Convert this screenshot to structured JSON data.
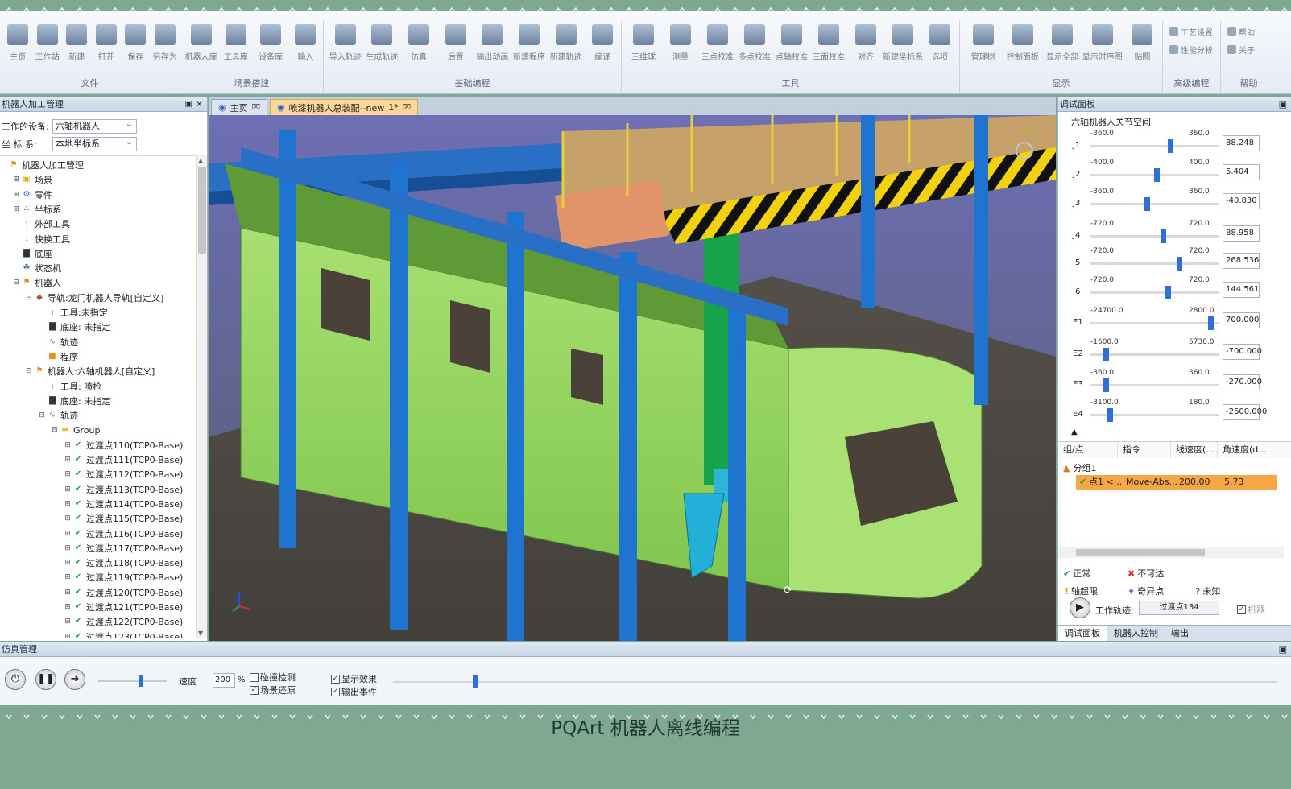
{
  "ribbon": {
    "groups": [
      {
        "label": "文件",
        "buttons": [
          "主页",
          "工作站",
          "新建",
          "打开",
          "保存",
          "另存为"
        ]
      },
      {
        "label": "场景搭建",
        "buttons": [
          "机器人库",
          "工具库",
          "设备库",
          "输入"
        ]
      },
      {
        "label": "基础编程",
        "buttons": [
          "导入轨迹",
          "生成轨迹",
          "仿真",
          "后置",
          "输出动画",
          "新建程序",
          "新建轨迹",
          "编译"
        ]
      },
      {
        "label": "工具",
        "buttons": [
          "三维球",
          "测量",
          "三点校准",
          "多点校准",
          "点轴校准",
          "三面校准",
          "对齐",
          "新建坐标系",
          "选项"
        ]
      },
      {
        "label": "显示",
        "buttons": [
          "管理树",
          "控制面板",
          "显示全部",
          "显示时序图",
          "贴图"
        ]
      },
      {
        "label": "高级编程",
        "buttons": [
          "工艺设置",
          "性能分析"
        ]
      },
      {
        "label": "帮助",
        "buttons": [
          "帮助",
          "关于"
        ]
      }
    ]
  },
  "left_panel": {
    "title": "机器人加工管理",
    "device_label": "工作的设备:",
    "device_value": "六轴机器人",
    "coord_label": "坐 标 系:",
    "coord_value": "本地坐标系",
    "tree": [
      {
        "label": "机器人加工管理",
        "icon": "robot-folder-icon",
        "indent": 0,
        "expand": ""
      },
      {
        "label": "场景",
        "icon": "scene-icon",
        "indent": 1,
        "expand": "+"
      },
      {
        "label": "零件",
        "icon": "part-icon",
        "indent": 1,
        "expand": "+"
      },
      {
        "label": "坐标系",
        "icon": "coordinate-icon",
        "indent": 1,
        "expand": "+"
      },
      {
        "label": "外部工具",
        "icon": "tool-icon",
        "indent": 1,
        "expand": ""
      },
      {
        "label": "快换工具",
        "icon": "tool-icon",
        "indent": 1,
        "expand": ""
      },
      {
        "label": "底座",
        "icon": "base-icon",
        "indent": 1,
        "expand": ""
      },
      {
        "label": "状态机",
        "icon": "state-machine-icon",
        "indent": 1,
        "expand": ""
      },
      {
        "label": "机器人",
        "icon": "robot-icon",
        "indent": 1,
        "expand": "-"
      },
      {
        "label": "导轨:龙门机器人导轨[自定义]",
        "icon": "rail-icon",
        "indent": 2,
        "expand": "-"
      },
      {
        "label": "工具:未指定",
        "icon": "tool-icon",
        "indent": 3,
        "expand": ""
      },
      {
        "label": "底座: 未指定",
        "icon": "base-icon",
        "indent": 3,
        "expand": ""
      },
      {
        "label": "轨迹",
        "icon": "path-icon",
        "indent": 3,
        "expand": ""
      },
      {
        "label": "程序",
        "icon": "program-icon",
        "indent": 3,
        "expand": ""
      },
      {
        "label": "机器人:六轴机器人[自定义]",
        "icon": "robot-icon",
        "indent": 2,
        "expand": "-"
      },
      {
        "label": "工具: 喷枪",
        "icon": "tool-icon",
        "indent": 3,
        "expand": ""
      },
      {
        "label": "底座: 未指定",
        "icon": "base-icon",
        "indent": 3,
        "expand": ""
      },
      {
        "label": "轨迹",
        "icon": "path-icon",
        "indent": 3,
        "expand": "-"
      },
      {
        "label": "Group",
        "icon": "folder-icon",
        "indent": 4,
        "expand": "-"
      },
      {
        "label": "过渡点110(TCP0-Base)",
        "icon": "check-icon",
        "indent": 5,
        "expand": "+"
      },
      {
        "label": "过渡点111(TCP0-Base)",
        "icon": "check-icon",
        "indent": 5,
        "expand": "+"
      },
      {
        "label": "过渡点112(TCP0-Base)",
        "icon": "check-icon",
        "indent": 5,
        "expand": "+"
      },
      {
        "label": "过渡点113(TCP0-Base)",
        "icon": "check-icon",
        "indent": 5,
        "expand": "+"
      },
      {
        "label": "过渡点114(TCP0-Base)",
        "icon": "check-icon",
        "indent": 5,
        "expand": "+"
      },
      {
        "label": "过渡点115(TCP0-Base)",
        "icon": "check-icon",
        "indent": 5,
        "expand": "+"
      },
      {
        "label": "过渡点116(TCP0-Base)",
        "icon": "check-icon",
        "indent": 5,
        "expand": "+"
      },
      {
        "label": "过渡点117(TCP0-Base)",
        "icon": "check-icon",
        "indent": 5,
        "expand": "+"
      },
      {
        "label": "过渡点118(TCP0-Base)",
        "icon": "check-icon",
        "indent": 5,
        "expand": "+"
      },
      {
        "label": "过渡点119(TCP0-Base)",
        "icon": "check-icon",
        "indent": 5,
        "expand": "+"
      },
      {
        "label": "过渡点120(TCP0-Base)",
        "icon": "check-icon",
        "indent": 5,
        "expand": "+"
      },
      {
        "label": "过渡点121(TCP0-Base)",
        "icon": "check-icon",
        "indent": 5,
        "expand": "+"
      },
      {
        "label": "过渡点122(TCP0-Base)",
        "icon": "check-icon",
        "indent": 5,
        "expand": "+"
      },
      {
        "label": "过渡点123(TCP0-Base)",
        "icon": "check-icon",
        "indent": 5,
        "expand": "+"
      }
    ]
  },
  "doc_tabs": [
    {
      "label": "主页",
      "active": false
    },
    {
      "label": "喷漆机器人总装配--new",
      "marker": "1*",
      "active": true
    }
  ],
  "right_panel": {
    "title": "调试面板",
    "joint_title": "六轴机器人关节空间",
    "joints": [
      {
        "name": "J1",
        "min": "-360.0",
        "max": "360.0",
        "value": "88.248",
        "level": 0.62
      },
      {
        "name": "J2",
        "min": "-400.0",
        "max": "400.0",
        "value": "5.404",
        "level": 0.51
      },
      {
        "name": "J3",
        "min": "-360.0",
        "max": "360.0",
        "value": "-40.830",
        "level": 0.44
      },
      {
        "name": "J4",
        "min": "-720.0",
        "max": "720.0",
        "value": "88.958",
        "level": 0.56
      },
      {
        "name": "J5",
        "min": "-720.0",
        "max": "720.0",
        "value": "268.536",
        "level": 0.69
      },
      {
        "name": "J6",
        "min": "-720.0",
        "max": "720.0",
        "value": "144.561",
        "level": 0.6
      },
      {
        "name": "E1",
        "min": "-24700.0",
        "max": "2800.0",
        "value": "700.000",
        "level": 0.93
      },
      {
        "name": "E2",
        "min": "-1600.0",
        "max": "5730.0",
        "value": "-700.000",
        "level": 0.12
      },
      {
        "name": "E3",
        "min": "-360.0",
        "max": "360.0",
        "value": "-270.000",
        "level": 0.12
      },
      {
        "name": "E4",
        "min": "-3100.0",
        "max": "180.0",
        "value": "-2600.000",
        "level": 0.15
      }
    ],
    "table_headers": [
      "组/点",
      "指令",
      "线速度(...",
      "角速度(d..."
    ],
    "group_label": "分组1",
    "point_row": {
      "name": "点1 <...",
      "cmd": "Move-Abs...",
      "lin": "200.00",
      "ang": "5.73"
    },
    "legend": {
      "normal": "正常",
      "unreachable": "不可达",
      "axis_limit": "轴超限",
      "singular": "奇异点",
      "unknown": "未知"
    },
    "work_path_label": "工作轨迹:",
    "work_path_value": "过渡点134",
    "cut_label": "机器",
    "tabs": [
      "调试面板",
      "机器人控制",
      "输出"
    ]
  },
  "sim": {
    "title": "仿真管理",
    "speed_label": "速度",
    "speed_value": "200",
    "percent": "%",
    "checks": [
      {
        "label": "碰撞检测",
        "checked": false
      },
      {
        "label": "场景还原",
        "checked": true
      },
      {
        "label": "显示效果",
        "checked": true
      },
      {
        "label": "输出事件",
        "checked": true
      }
    ],
    "speed_level": 0.6,
    "progress_level": 0.09
  },
  "caption": "PQArt 机器人离线编程",
  "colors": {
    "frame_green": "#7fa892",
    "pillar_blue": "#1f74d0",
    "train_green": "#9ad866",
    "selected_row": "#f5a646"
  }
}
